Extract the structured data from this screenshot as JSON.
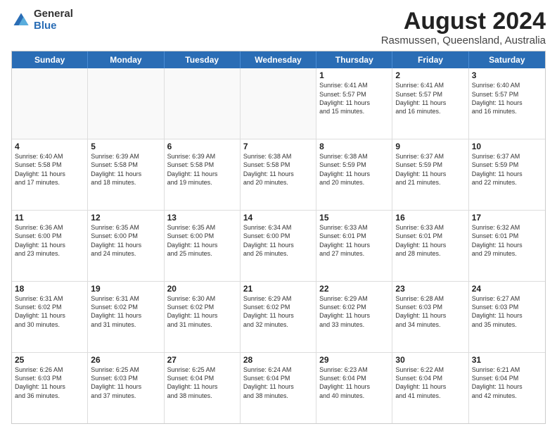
{
  "logo": {
    "general": "General",
    "blue": "Blue"
  },
  "title": "August 2024",
  "subtitle": "Rasmussen, Queensland, Australia",
  "days": [
    "Sunday",
    "Monday",
    "Tuesday",
    "Wednesday",
    "Thursday",
    "Friday",
    "Saturday"
  ],
  "rows": [
    [
      {
        "day": "",
        "text": ""
      },
      {
        "day": "",
        "text": ""
      },
      {
        "day": "",
        "text": ""
      },
      {
        "day": "",
        "text": ""
      },
      {
        "day": "1",
        "text": "Sunrise: 6:41 AM\nSunset: 5:57 PM\nDaylight: 11 hours\nand 15 minutes."
      },
      {
        "day": "2",
        "text": "Sunrise: 6:41 AM\nSunset: 5:57 PM\nDaylight: 11 hours\nand 16 minutes."
      },
      {
        "day": "3",
        "text": "Sunrise: 6:40 AM\nSunset: 5:57 PM\nDaylight: 11 hours\nand 16 minutes."
      }
    ],
    [
      {
        "day": "4",
        "text": "Sunrise: 6:40 AM\nSunset: 5:58 PM\nDaylight: 11 hours\nand 17 minutes."
      },
      {
        "day": "5",
        "text": "Sunrise: 6:39 AM\nSunset: 5:58 PM\nDaylight: 11 hours\nand 18 minutes."
      },
      {
        "day": "6",
        "text": "Sunrise: 6:39 AM\nSunset: 5:58 PM\nDaylight: 11 hours\nand 19 minutes."
      },
      {
        "day": "7",
        "text": "Sunrise: 6:38 AM\nSunset: 5:58 PM\nDaylight: 11 hours\nand 20 minutes."
      },
      {
        "day": "8",
        "text": "Sunrise: 6:38 AM\nSunset: 5:59 PM\nDaylight: 11 hours\nand 20 minutes."
      },
      {
        "day": "9",
        "text": "Sunrise: 6:37 AM\nSunset: 5:59 PM\nDaylight: 11 hours\nand 21 minutes."
      },
      {
        "day": "10",
        "text": "Sunrise: 6:37 AM\nSunset: 5:59 PM\nDaylight: 11 hours\nand 22 minutes."
      }
    ],
    [
      {
        "day": "11",
        "text": "Sunrise: 6:36 AM\nSunset: 6:00 PM\nDaylight: 11 hours\nand 23 minutes."
      },
      {
        "day": "12",
        "text": "Sunrise: 6:35 AM\nSunset: 6:00 PM\nDaylight: 11 hours\nand 24 minutes."
      },
      {
        "day": "13",
        "text": "Sunrise: 6:35 AM\nSunset: 6:00 PM\nDaylight: 11 hours\nand 25 minutes."
      },
      {
        "day": "14",
        "text": "Sunrise: 6:34 AM\nSunset: 6:00 PM\nDaylight: 11 hours\nand 26 minutes."
      },
      {
        "day": "15",
        "text": "Sunrise: 6:33 AM\nSunset: 6:01 PM\nDaylight: 11 hours\nand 27 minutes."
      },
      {
        "day": "16",
        "text": "Sunrise: 6:33 AM\nSunset: 6:01 PM\nDaylight: 11 hours\nand 28 minutes."
      },
      {
        "day": "17",
        "text": "Sunrise: 6:32 AM\nSunset: 6:01 PM\nDaylight: 11 hours\nand 29 minutes."
      }
    ],
    [
      {
        "day": "18",
        "text": "Sunrise: 6:31 AM\nSunset: 6:02 PM\nDaylight: 11 hours\nand 30 minutes."
      },
      {
        "day": "19",
        "text": "Sunrise: 6:31 AM\nSunset: 6:02 PM\nDaylight: 11 hours\nand 31 minutes."
      },
      {
        "day": "20",
        "text": "Sunrise: 6:30 AM\nSunset: 6:02 PM\nDaylight: 11 hours\nand 31 minutes."
      },
      {
        "day": "21",
        "text": "Sunrise: 6:29 AM\nSunset: 6:02 PM\nDaylight: 11 hours\nand 32 minutes."
      },
      {
        "day": "22",
        "text": "Sunrise: 6:29 AM\nSunset: 6:02 PM\nDaylight: 11 hours\nand 33 minutes."
      },
      {
        "day": "23",
        "text": "Sunrise: 6:28 AM\nSunset: 6:03 PM\nDaylight: 11 hours\nand 34 minutes."
      },
      {
        "day": "24",
        "text": "Sunrise: 6:27 AM\nSunset: 6:03 PM\nDaylight: 11 hours\nand 35 minutes."
      }
    ],
    [
      {
        "day": "25",
        "text": "Sunrise: 6:26 AM\nSunset: 6:03 PM\nDaylight: 11 hours\nand 36 minutes."
      },
      {
        "day": "26",
        "text": "Sunrise: 6:25 AM\nSunset: 6:03 PM\nDaylight: 11 hours\nand 37 minutes."
      },
      {
        "day": "27",
        "text": "Sunrise: 6:25 AM\nSunset: 6:04 PM\nDaylight: 11 hours\nand 38 minutes."
      },
      {
        "day": "28",
        "text": "Sunrise: 6:24 AM\nSunset: 6:04 PM\nDaylight: 11 hours\nand 38 minutes."
      },
      {
        "day": "29",
        "text": "Sunrise: 6:23 AM\nSunset: 6:04 PM\nDaylight: 11 hours\nand 40 minutes."
      },
      {
        "day": "30",
        "text": "Sunrise: 6:22 AM\nSunset: 6:04 PM\nDaylight: 11 hours\nand 41 minutes."
      },
      {
        "day": "31",
        "text": "Sunrise: 6:21 AM\nSunset: 6:04 PM\nDaylight: 11 hours\nand 42 minutes."
      }
    ]
  ]
}
